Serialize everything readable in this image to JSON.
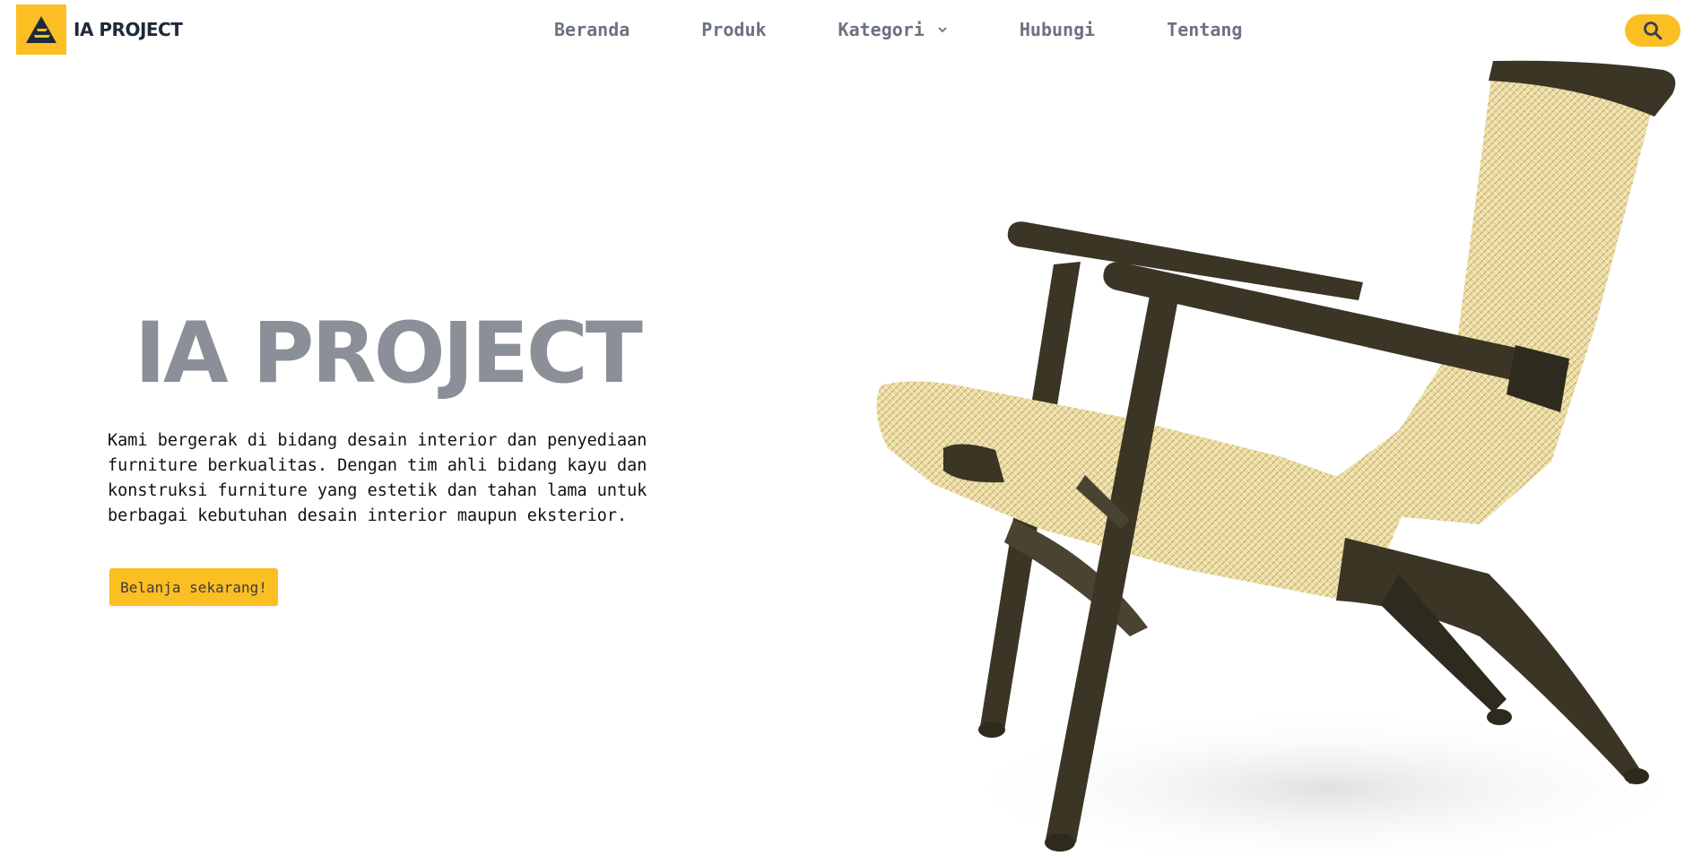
{
  "navbar": {
    "brand_name": "IA PROJECT",
    "links": [
      {
        "label": "Beranda"
      },
      {
        "label": "Produk"
      },
      {
        "label": "Kategori"
      },
      {
        "label": "Hubungi"
      },
      {
        "label": "Tentang"
      }
    ],
    "search_icon": "search-icon",
    "dropdown_icon": "chevron-down-icon"
  },
  "hero": {
    "title": "IA PROJECT",
    "description": "Kami bergerak di bidang desain interior dan penyediaan furniture berkualitas. Dengan tim ahli bidang kayu dan konstruksi furniture yang estetik dan tahan lama untuk berbagai kebutuhan desain interior maupun eksterior.",
    "cta_label": "Belanja sekarang!",
    "image": "wooden-lounge-chair-with-woven-cord-seat"
  },
  "colors": {
    "accent": "#fbbf24",
    "title_gray": "#8a8f98",
    "nav_text": "#6b7280",
    "brand_text": "#1f2937",
    "chair_wood": "#3b3526",
    "chair_weave": "#ecdca5"
  }
}
